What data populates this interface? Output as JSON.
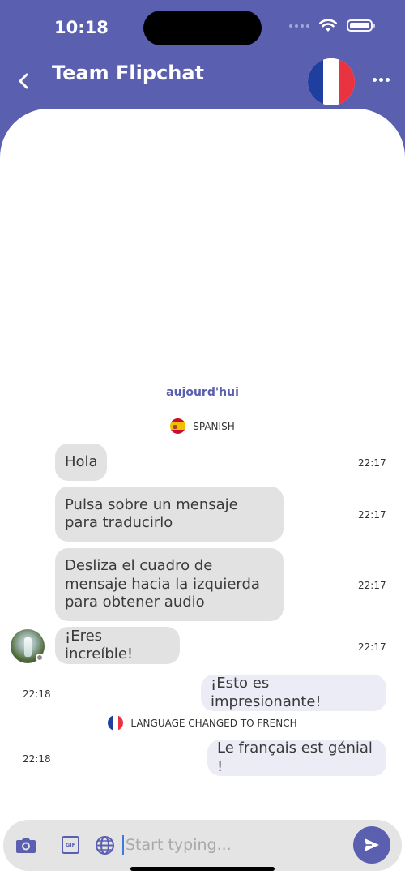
{
  "status_bar": {
    "time": "10:18"
  },
  "header": {
    "title": "Team Flipchat",
    "avatar_flag": "france-flag"
  },
  "chat": {
    "date_separator": "aujourd'hui",
    "language_note_1": "SPANISH",
    "messages_in": [
      {
        "text": "Hola",
        "time": "22:17"
      },
      {
        "text": "Pulsa sobre un mensaje para traducirlo",
        "time": "22:17"
      },
      {
        "text": "Desliza el cuadro de mensaje hacia la izquierda para obtener audio",
        "time": "22:17"
      },
      {
        "text": "¡Eres increíble!",
        "time": "22:17"
      }
    ],
    "message_out_1": {
      "text": "¡Esto es impresionante!",
      "time": "22:18"
    },
    "language_note_2": "LANGUAGE CHANGED TO FRENCH",
    "message_out_2": {
      "text": "Le français est génial !",
      "time": "22:18"
    }
  },
  "composer": {
    "placeholder": "Start typing...",
    "gif_label": "GIF"
  },
  "colors": {
    "brand": "#5a5fb0",
    "incoming_bubble": "#e2e2e2",
    "outgoing_bubble": "#ececf6"
  }
}
